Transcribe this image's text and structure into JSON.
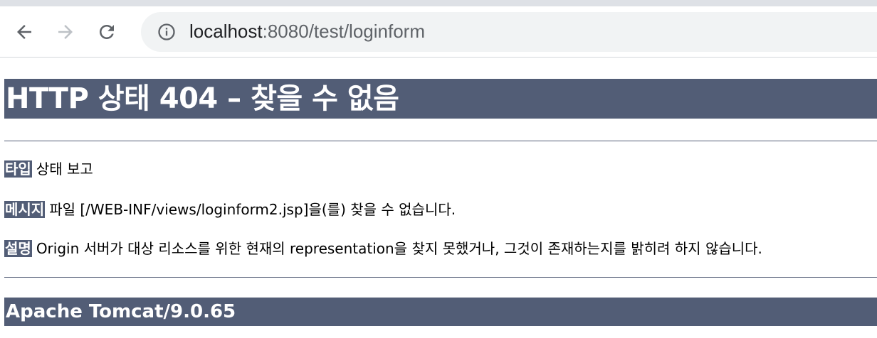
{
  "browser": {
    "url_host": "localhost",
    "url_rest": ":8080/test/loginform",
    "icons": [
      "back-icon",
      "forward-icon",
      "reload-icon",
      "info-icon"
    ]
  },
  "page": {
    "heading": "HTTP 상태 404 – 찾을 수 없음",
    "type_label": "타입",
    "type_value": "상태 보고",
    "message_label": "메시지",
    "message_value": "파일 [/WEB-INF/views/loginform2.jsp]을(를) 찾을 수 없습니다.",
    "description_label": "설명",
    "description_value": "Origin 서버가 대상 리소스를 위한 현재의 representation을 찾지 못했거나, 그것이 존재하는지를 밝히려 하지 않습니다.",
    "footer": "Apache Tomcat/9.0.65"
  },
  "colors": {
    "accent": "#525d76"
  }
}
